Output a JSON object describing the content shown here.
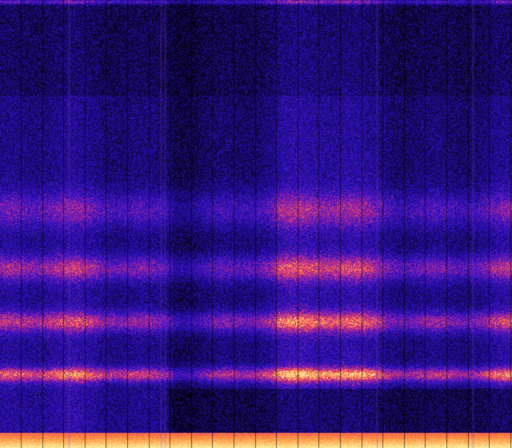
{
  "view": {
    "kind": "spectrogram",
    "colormap": [
      "#000000",
      "#1a0a6e",
      "#2a10c8",
      "#7a1fb0",
      "#e0307a",
      "#ff8a3a",
      "#fff3a0"
    ],
    "background": "#000000",
    "frequency_bands": [
      {
        "name": "band-low",
        "level": 0.92
      },
      {
        "name": "band-2",
        "level": 0.72
      },
      {
        "name": "band-3",
        "level": 0.62
      },
      {
        "name": "band-4",
        "level": 0.45
      },
      {
        "name": "band-top-edge",
        "level": 0.55
      }
    ],
    "vertical_streaks": true,
    "bright_floor": true
  }
}
